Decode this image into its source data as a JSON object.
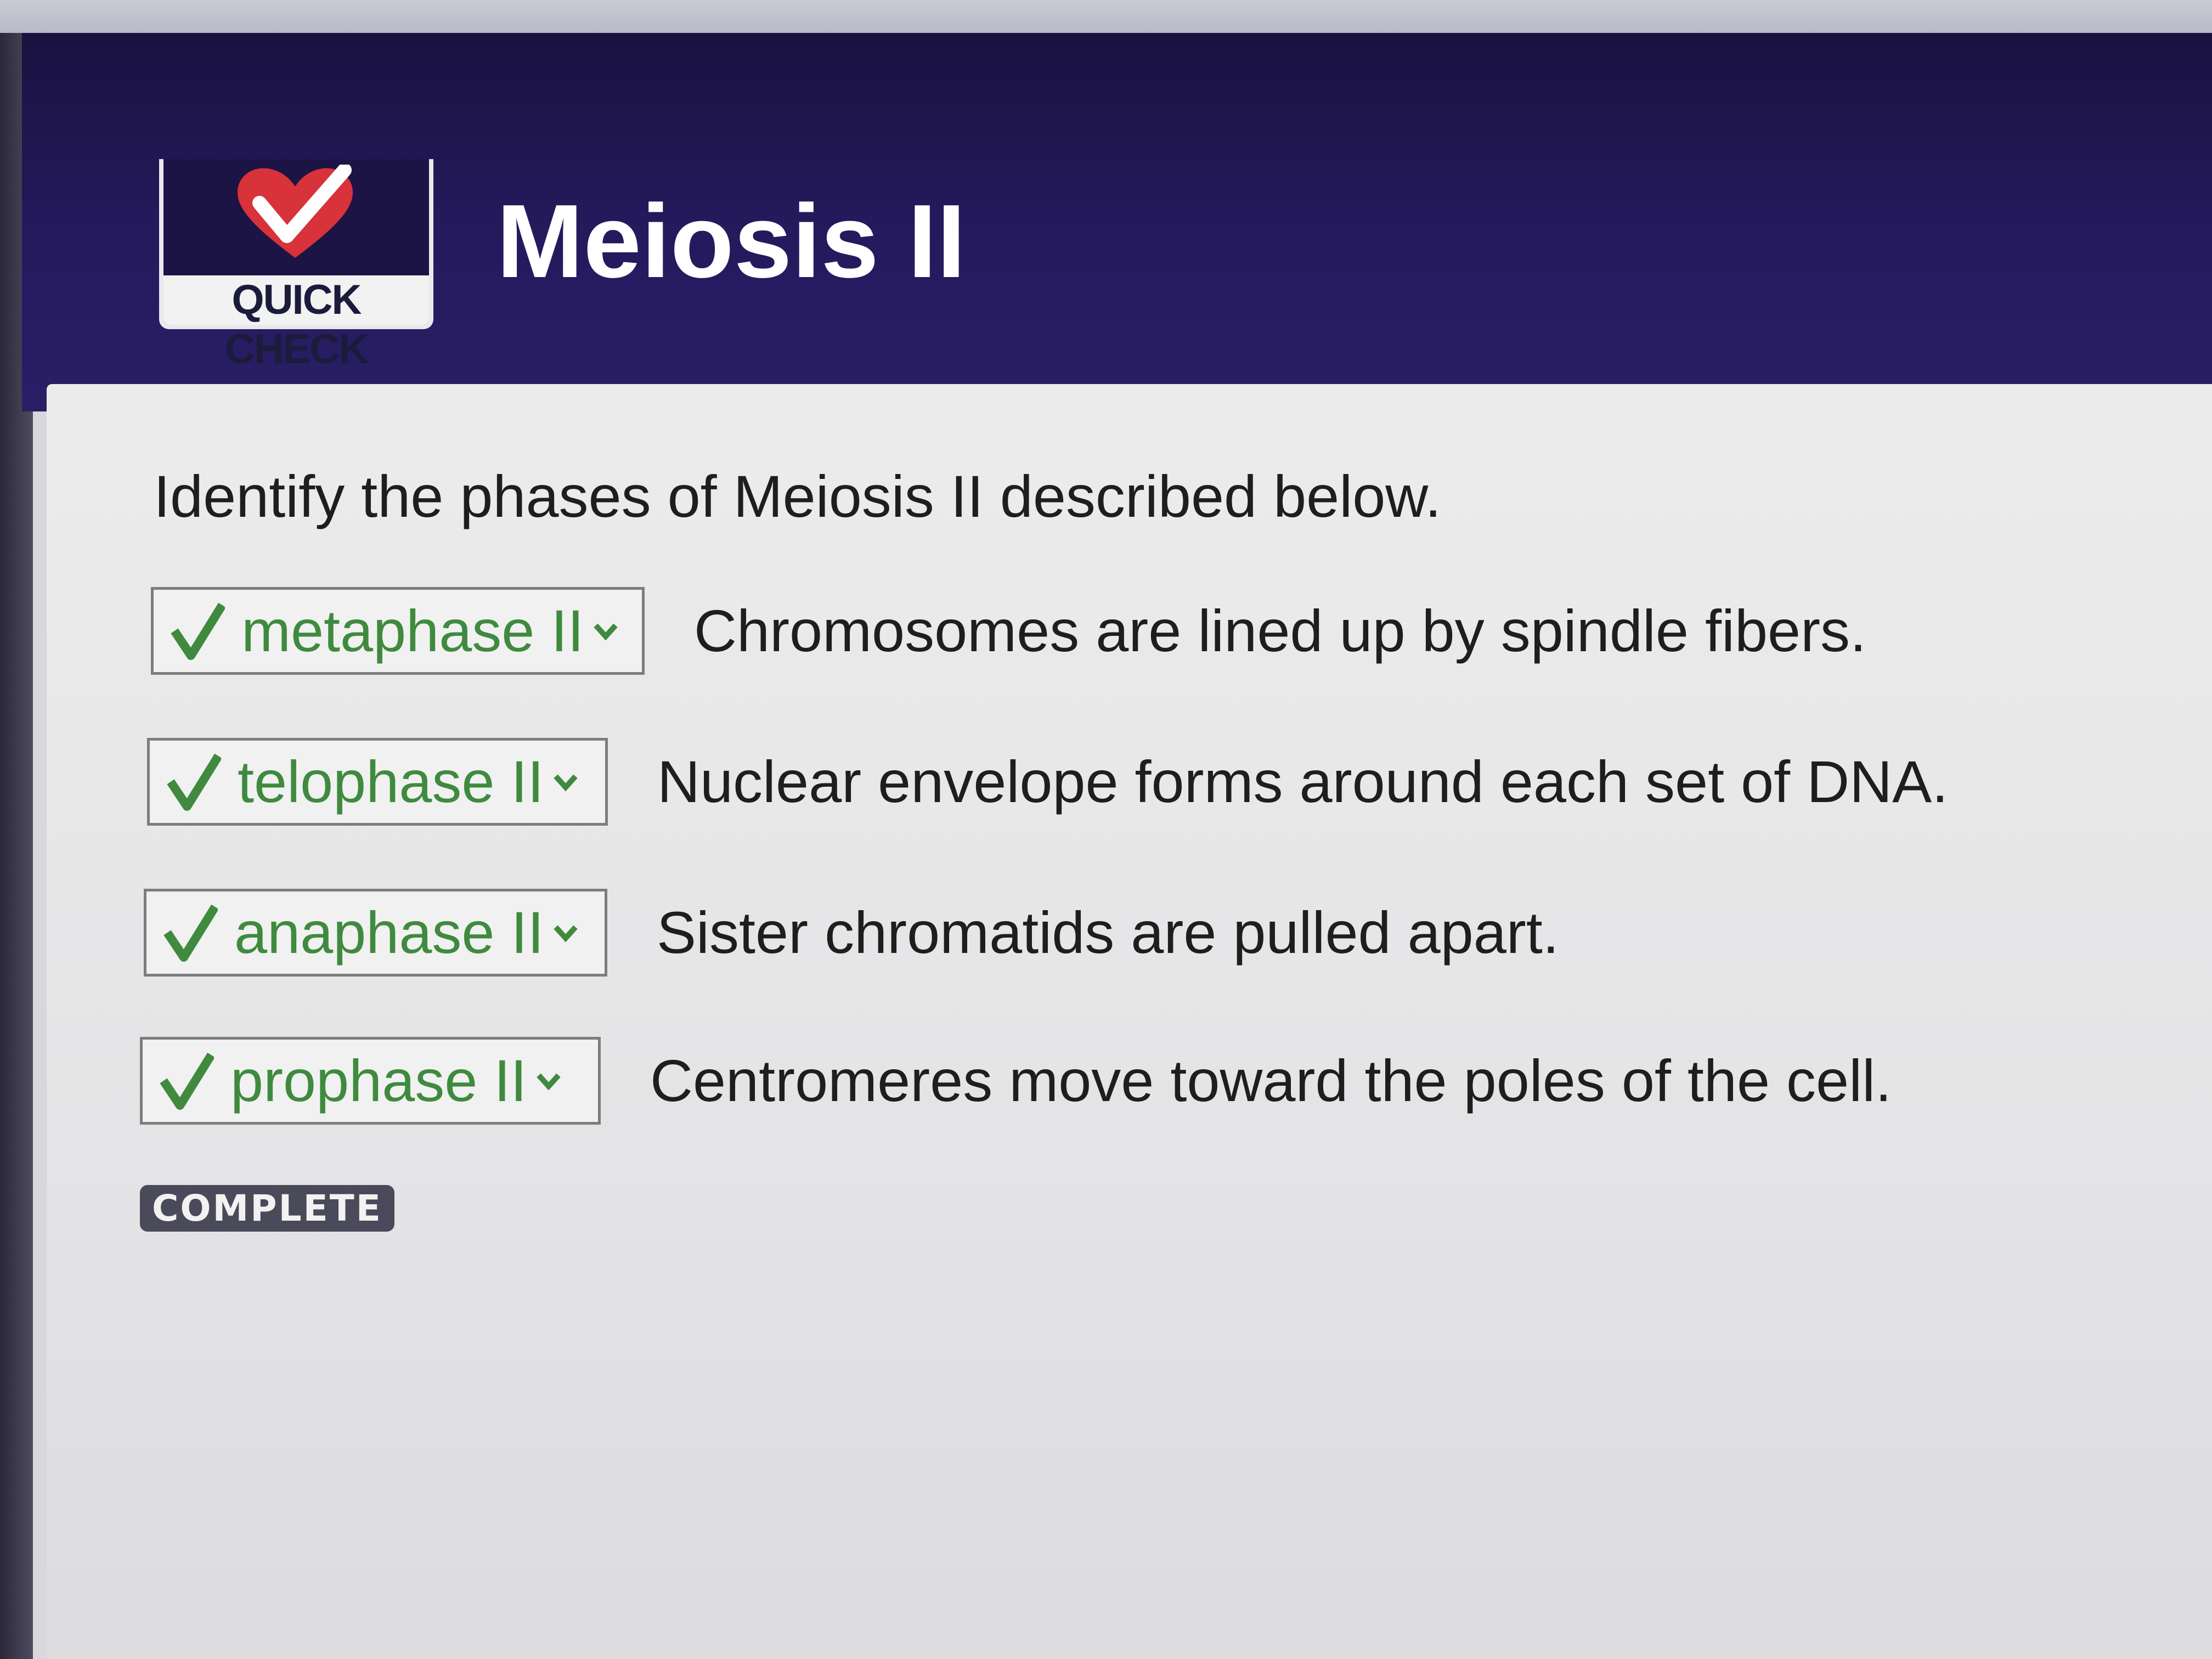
{
  "header": {
    "logo_label": "QUICK CHECK",
    "title": "Meiosis II"
  },
  "instruction": "Identify the phases of Meiosis II described below.",
  "questions": [
    {
      "answer": "metaphase II",
      "statement": "Chromosomes are lined up by spindle fibers."
    },
    {
      "answer": "telophase II",
      "statement": "Nuclear envelope forms around each set of DNA."
    },
    {
      "answer": "anaphase II",
      "statement": "Sister chromatids are pulled apart."
    },
    {
      "answer": "prophase II",
      "statement": "Centromeres move toward the poles of the cell."
    }
  ],
  "status": "COMPLETE",
  "colors": {
    "header_bg": "#251a5e",
    "correct_answer": "#3f8a3f",
    "check_mark": "#3f8a3f",
    "logo_heart": "#d8323a",
    "status_badge": "#4a4a5a"
  },
  "icons": {
    "logo": "heart-check-icon",
    "correct": "checkmark-icon",
    "dropdown": "chevron-down-icon"
  }
}
